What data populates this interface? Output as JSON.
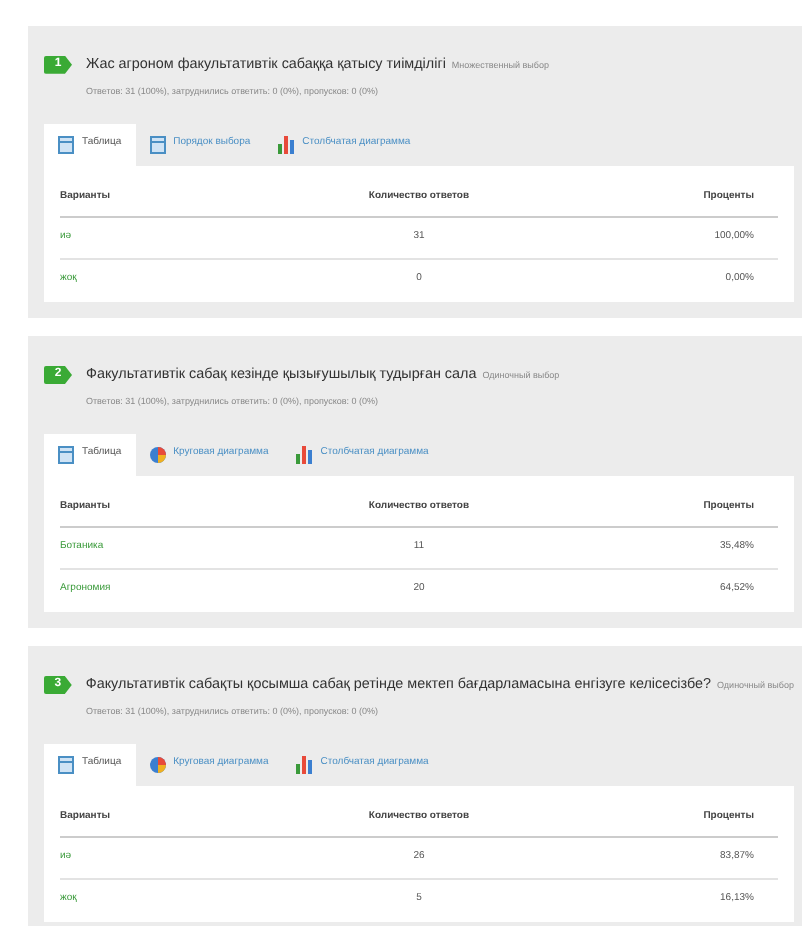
{
  "questions": [
    {
      "number": "1",
      "title": "Жас агроном факультативтік сабаққа қатысу тиімділігі",
      "type": "Множественный выбор",
      "stats": "Ответов: 31 (100%), затруднились ответить: 0 (0%), пропусков: 0 (0%)",
      "tabs": [
        {
          "label": "Таблица",
          "kind": "table",
          "selected": true
        },
        {
          "label": "Порядок выбора",
          "kind": "table",
          "selected": false
        },
        {
          "label": "Столбчатая диаграмма",
          "kind": "bar",
          "selected": false
        }
      ],
      "columns": [
        "Варианты",
        "Количество ответов",
        "Проценты"
      ],
      "rows": [
        {
          "option": "иә",
          "count": "31",
          "percent": "100,00%"
        },
        {
          "option": "жоқ",
          "count": "0",
          "percent": "0,00%"
        }
      ]
    },
    {
      "number": "2",
      "title": "Факультативтік сабақ кезінде қызығушылық тудырған сала",
      "type": "Одиночный выбор",
      "stats": "Ответов: 31 (100%), затруднились ответить: 0 (0%), пропусков: 0 (0%)",
      "tabs": [
        {
          "label": "Таблица",
          "kind": "table",
          "selected": true
        },
        {
          "label": "Круговая диаграмма",
          "kind": "pie",
          "selected": false
        },
        {
          "label": "Столбчатая диаграмма",
          "kind": "bar",
          "selected": false
        }
      ],
      "columns": [
        "Варианты",
        "Количество ответов",
        "Проценты"
      ],
      "rows": [
        {
          "option": "Ботаника",
          "count": "11",
          "percent": "35,48%"
        },
        {
          "option": "Агрономия",
          "count": "20",
          "percent": "64,52%"
        }
      ]
    },
    {
      "number": "3",
      "title": "Факультативтік сабақты қосымша сабақ ретінде мектеп бағдарламасына енгізуге келісесізбе?",
      "type": "Одиночный выбор",
      "stats": "Ответов: 31 (100%), затруднились ответить: 0 (0%), пропусков: 0 (0%)",
      "tabs": [
        {
          "label": "Таблица",
          "kind": "table",
          "selected": true
        },
        {
          "label": "Круговая диаграмма",
          "kind": "pie",
          "selected": false
        },
        {
          "label": "Столбчатая диаграмма",
          "kind": "bar",
          "selected": false
        }
      ],
      "columns": [
        "Варианты",
        "Количество ответов",
        "Проценты"
      ],
      "rows": [
        {
          "option": "иә",
          "count": "26",
          "percent": "83,87%"
        },
        {
          "option": "жоқ",
          "count": "5",
          "percent": "16,13%"
        }
      ]
    }
  ]
}
